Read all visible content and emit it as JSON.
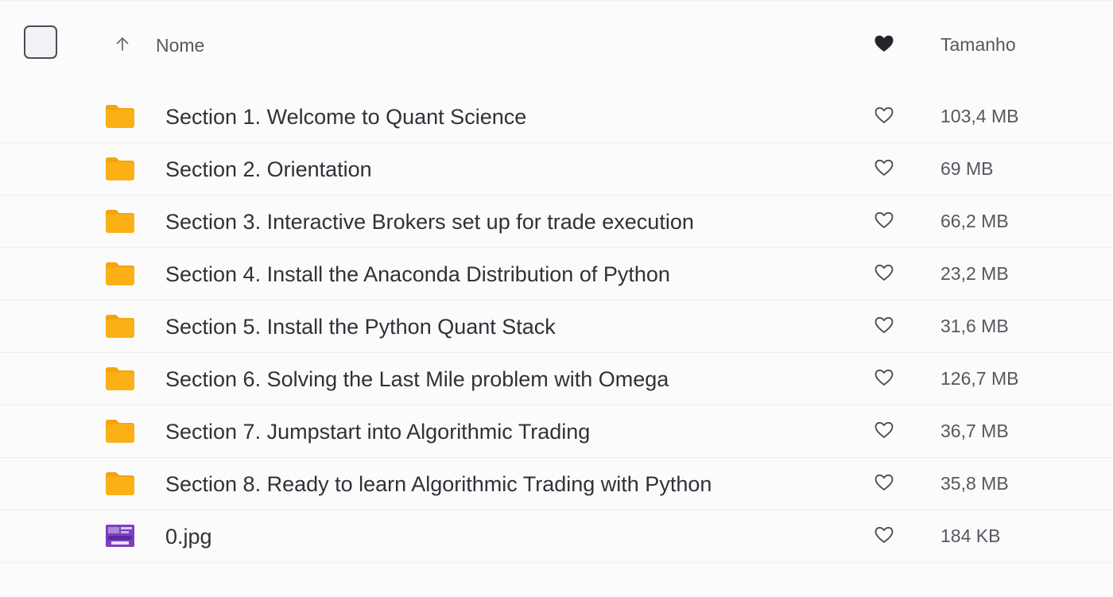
{
  "header": {
    "name_label": "Nome",
    "size_label": "Tamanho",
    "sort_icon": "arrow-up-icon",
    "favorite_icon": "heart-filled-icon"
  },
  "colors": {
    "folder": "#fbb016",
    "folder_tab": "#f6a30c",
    "text": "#2f3238",
    "muted_text": "#55595f",
    "image_thumb": "#7b3fbf"
  },
  "files": [
    {
      "name": "Section 1. Welcome to Quant Science",
      "size": "103,4 MB",
      "type": "folder",
      "icon": "folder-icon"
    },
    {
      "name": "Section 2. Orientation",
      "size": "69 MB",
      "type": "folder",
      "icon": "folder-icon"
    },
    {
      "name": "Section 3. Interactive Brokers set up for trade execution",
      "size": "66,2 MB",
      "type": "folder",
      "icon": "folder-icon"
    },
    {
      "name": "Section 4. Install the Anaconda Distribution of Python",
      "size": "23,2 MB",
      "type": "folder",
      "icon": "folder-icon"
    },
    {
      "name": "Section 5. Install the Python Quant Stack",
      "size": "31,6 MB",
      "type": "folder",
      "icon": "folder-icon"
    },
    {
      "name": "Section 6. Solving the Last Mile problem with Omega",
      "size": "126,7 MB",
      "type": "folder",
      "icon": "folder-icon"
    },
    {
      "name": "Section 7. Jumpstart into Algorithmic Trading",
      "size": "36,7 MB",
      "type": "folder",
      "icon": "folder-icon"
    },
    {
      "name": "Section 8. Ready to learn Algorithmic Trading with Python",
      "size": "35,8 MB",
      "type": "folder",
      "icon": "folder-icon"
    },
    {
      "name": "0.jpg",
      "size": "184 KB",
      "type": "image",
      "icon": "image-thumbnail-icon"
    }
  ]
}
